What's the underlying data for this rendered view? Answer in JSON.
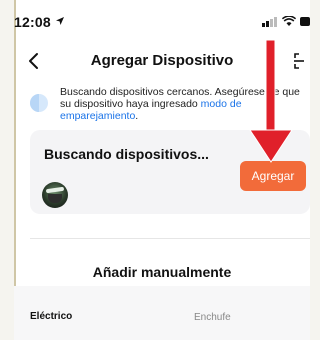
{
  "status_bar": {
    "time": "12:08"
  },
  "nav": {
    "title": "Agregar Dispositivo"
  },
  "info": {
    "text": "Buscando dispositivos cercanos. Asegúrese de que su dispositivo haya ingresado ",
    "link": "modo de emparejamiento",
    "suffix": "."
  },
  "card": {
    "title": "Buscando dispositivos...",
    "add_label": "Agregar"
  },
  "manual": {
    "title": "Añadir manualmente"
  },
  "categories": {
    "left": "Eléctrico",
    "right": "Enchufe"
  },
  "colors": {
    "accent": "#f26b3a",
    "link": "#1a73e8",
    "annotation": "#e0202a"
  }
}
